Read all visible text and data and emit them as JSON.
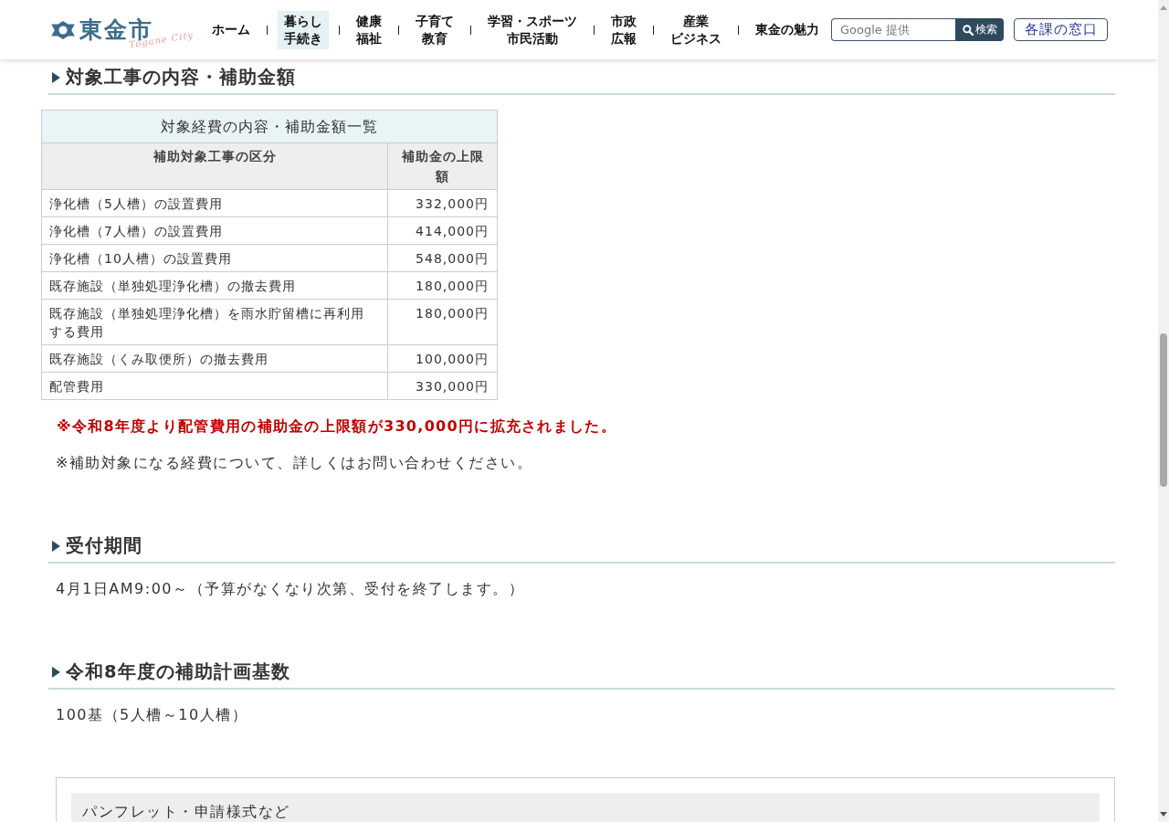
{
  "header": {
    "logo": {
      "name": "東金市",
      "tagline": "Togane City"
    },
    "nav": [
      {
        "lines": [
          "ホーム"
        ],
        "selected": false
      },
      {
        "lines": [
          "暮らし",
          "手続き"
        ],
        "selected": true
      },
      {
        "lines": [
          "健康",
          "福祉"
        ],
        "selected": false
      },
      {
        "lines": [
          "子育て",
          "教育"
        ],
        "selected": false
      },
      {
        "lines": [
          "学習・スポーツ",
          "市民活動"
        ],
        "selected": false
      },
      {
        "lines": [
          "市政",
          "広報"
        ],
        "selected": false
      },
      {
        "lines": [
          "産業",
          "ビジネス"
        ],
        "selected": false
      },
      {
        "lines": [
          "東金の魅力"
        ],
        "selected": false
      }
    ],
    "search": {
      "placeholder": "Google 提供",
      "button": "検索"
    },
    "counter_link": "各課の窓口"
  },
  "sections": [
    {
      "heading": "対象工事の内容・補助金額",
      "content": [
        {
          "kind": "table",
          "caption": "対象経費の内容・補助金額一覧",
          "columns": [
            "補助対象工事の区分",
            "補助金の上限額"
          ],
          "rows": [
            {
              "item": "浄化槽（5人槽）の設置費用",
              "amount": "332,000円"
            },
            {
              "item": "浄化槽（7人槽）の設置費用",
              "amount": "414,000円"
            },
            {
              "item": "浄化槽（10人槽）の設置費用",
              "amount": "548,000円"
            },
            {
              "item": "既存施設（単独処理浄化槽）の撤去費用",
              "amount": "180,000円"
            },
            {
              "item": "既存施設（単独処理浄化槽）を雨水貯留槽に再利用する費用",
              "amount": "180,000円"
            },
            {
              "item": "既存施設（くみ取便所）の撤去費用",
              "amount": "100,000円"
            },
            {
              "item": "配管費用",
              "amount": "330,000円"
            }
          ]
        },
        {
          "kind": "alert",
          "text": "※令和8年度より配管費用の補助金の上限額が330,000円に拡充されました。"
        },
        {
          "kind": "text",
          "text": "※補助対象になる経費について、詳しくはお問い合わせください。"
        }
      ]
    },
    {
      "heading": "受付期間",
      "content": [
        {
          "kind": "text",
          "text": "4月1日AM9:00～（予算がなくなり次第、受付を終了します。）"
        }
      ]
    },
    {
      "heading": "令和8年度の補助計画基数",
      "content": [
        {
          "kind": "text",
          "text": "100基（5人槽～10人槽）"
        }
      ]
    }
  ],
  "related_panel": {
    "title": "パンフレット・申請様式など"
  }
}
